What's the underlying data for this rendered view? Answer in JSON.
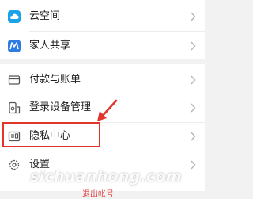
{
  "menu": {
    "cloud_label": "云空间",
    "family_label": "家人共享",
    "payment_label": "付款与账单",
    "device_label": "登录设备管理",
    "privacy_label": "隐私中心",
    "settings_label": "设置"
  },
  "footer": {
    "logout_label": "退出帐号"
  },
  "watermark": {
    "text": "sichuanhong.com"
  },
  "icons": {
    "cloud": "cloud-icon",
    "family": "family-share-icon",
    "payment": "wallet-icon",
    "device": "device-manage-icon",
    "privacy": "privacy-center-icon",
    "settings": "gear-icon"
  },
  "colors": {
    "cloud_icon": "#1aa3e8",
    "family_icon": "#2f7be5",
    "highlight": "#e0352b",
    "logout_text": "#e23b3b"
  }
}
